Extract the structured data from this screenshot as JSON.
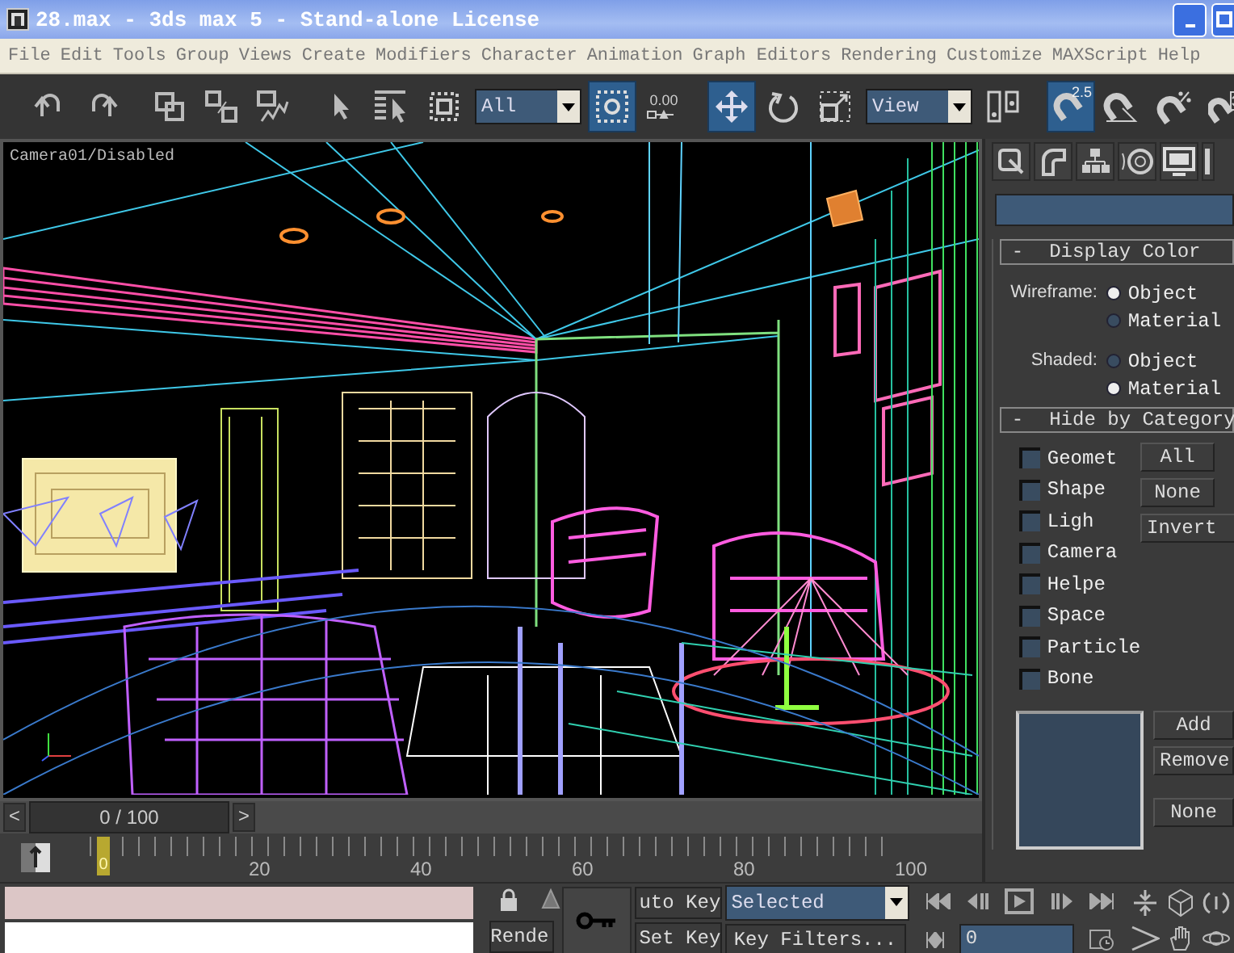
{
  "window": {
    "title": "28.max - 3ds max 5 - Stand-alone License"
  },
  "menu": [
    "File",
    "Edit",
    "Tools",
    "Group",
    "Views",
    "Create",
    "Modifiers",
    "Character",
    "Animation",
    "Graph Editors",
    "Rendering",
    "Customize",
    "MAXScript",
    "Help"
  ],
  "toolbar": {
    "selection_filter": "All",
    "window_crossing": {
      "selected": true
    },
    "spinner_snap_value": "0.00",
    "move": {
      "selected": true
    },
    "rotate": {
      "selected": false
    },
    "scale": {
      "selected": false
    },
    "reference_coordinate_system": "View",
    "snap": {
      "label": "2.5",
      "selected": true
    },
    "angle_snap": {
      "selected": false
    },
    "percent_snap": {
      "selected": false
    }
  },
  "viewport": {
    "label": "Camera01/Disabled"
  },
  "command_panel": {
    "display_color": {
      "toggle": "-",
      "title": "Display Color",
      "groups": [
        {
          "label": "Wireframe:",
          "options": [
            {
              "label": "Object",
              "selected": true
            },
            {
              "label": "Material",
              "selected": false
            }
          ]
        },
        {
          "label": "Shaded:",
          "options": [
            {
              "label": "Object",
              "selected": false
            },
            {
              "label": "Material",
              "selected": true
            }
          ]
        }
      ]
    },
    "hide_by_category": {
      "toggle": "-",
      "title": "Hide by Category",
      "items": [
        {
          "label": "Geomet",
          "checked": false
        },
        {
          "label": "Shape",
          "checked": false
        },
        {
          "label": "Ligh",
          "checked": false
        },
        {
          "label": "Camera",
          "checked": false
        },
        {
          "label": "Helpe",
          "checked": false
        },
        {
          "label": "Space",
          "checked": false
        },
        {
          "label": "Particle",
          "checked": false
        },
        {
          "label": "Bone",
          "checked": false
        }
      ],
      "buttons": [
        "All",
        "None",
        "Invert"
      ]
    },
    "selection_buttons": [
      "Add",
      "Remove",
      "None"
    ]
  },
  "timeline": {
    "prev": "<",
    "frame": "0 / 100",
    "next": ">",
    "current": "0",
    "ruler_labels": [
      "20",
      "40",
      "60",
      "80",
      "100"
    ]
  },
  "status": {
    "render_button": "Rende"
  },
  "animation": {
    "auto_key": "uto Key",
    "set_key": "Set Key",
    "key_filter": "Selected",
    "key_filters_button": "Key Filters...",
    "current_frame": "0"
  }
}
